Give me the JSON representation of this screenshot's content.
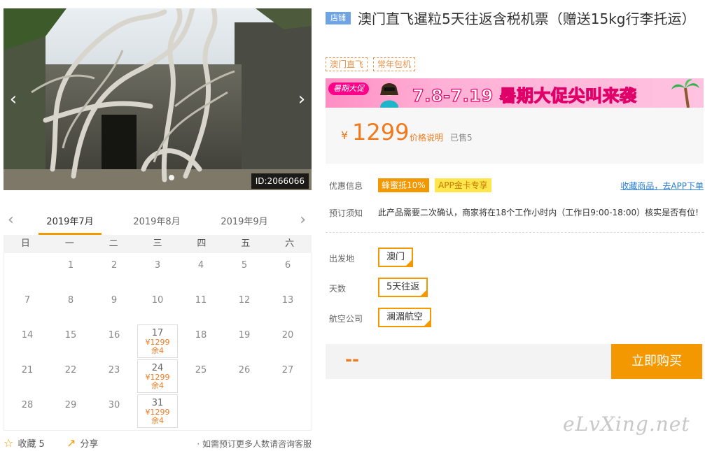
{
  "gallery": {
    "image_id": "ID:2066066",
    "prev_icon": "‹",
    "next_icon": "›"
  },
  "calendar": {
    "prev_icon": "‹",
    "next_icon": "›",
    "months": [
      "2019年7月",
      "2019年8月",
      "2019年9月"
    ],
    "active_month": 0,
    "weekdays": [
      "日",
      "一",
      "二",
      "三",
      "四",
      "五",
      "六"
    ],
    "rows": [
      [
        "",
        "",
        "1",
        "2",
        "3",
        "4",
        "5",
        "6"
      ],
      [
        "7",
        "8",
        "9",
        "10",
        "11",
        "12",
        "13"
      ],
      [
        "14",
        "15",
        "16",
        "17",
        "18",
        "19",
        "20"
      ],
      [
        "21",
        "22",
        "23",
        "24",
        "25",
        "26",
        "27"
      ],
      [
        "28",
        "29",
        "30",
        "31",
        "",
        "",
        ""
      ]
    ],
    "available": {
      "17": {
        "price": "¥1299",
        "stock": "余4"
      },
      "24": {
        "price": "¥1299",
        "stock": "余4"
      },
      "31": {
        "price": "¥1299",
        "stock": "余4"
      }
    }
  },
  "footer": {
    "favorite_label": "收藏 5",
    "share_label": "分享",
    "note": "· 如需预订更多人数请咨询客服"
  },
  "product": {
    "shop_badge": "店铺",
    "title": "澳门直飞暹粒5天往返含税机票（赠送15kg行李托运）",
    "tags": [
      "澳门直飞",
      "常年包机"
    ],
    "promo": {
      "pill": "暑期大促",
      "text": "7.8-7.19 暑期大促尖叫来袭"
    },
    "price": {
      "currency": "¥",
      "amount": "1299",
      "explain_label": "价格说明",
      "sold": "已售5"
    },
    "discount_label": "优惠信息",
    "discounts": [
      "蜂蜜抵10%",
      "APP金卡专享"
    ],
    "app_link": "收藏商品，去APP下单",
    "notice_label": "预订须知",
    "notice": "此产品需要二次确认，商家将在18个工作小时内（工作日9:00-18:00）核实是否有位!",
    "options": [
      {
        "label": "出发地",
        "value": "澳门"
      },
      {
        "label": "天数",
        "value": "5天往返"
      },
      {
        "label": "航空公司",
        "value": "澜湄航空"
      }
    ],
    "total_placeholder": "--",
    "buy_label": "立即购买"
  },
  "watermark": "eLvXing.net",
  "colors": {
    "accent": "#f39800",
    "price": "#f07a1e",
    "link": "#2a7fd4",
    "badge": "#6ea3e6"
  }
}
